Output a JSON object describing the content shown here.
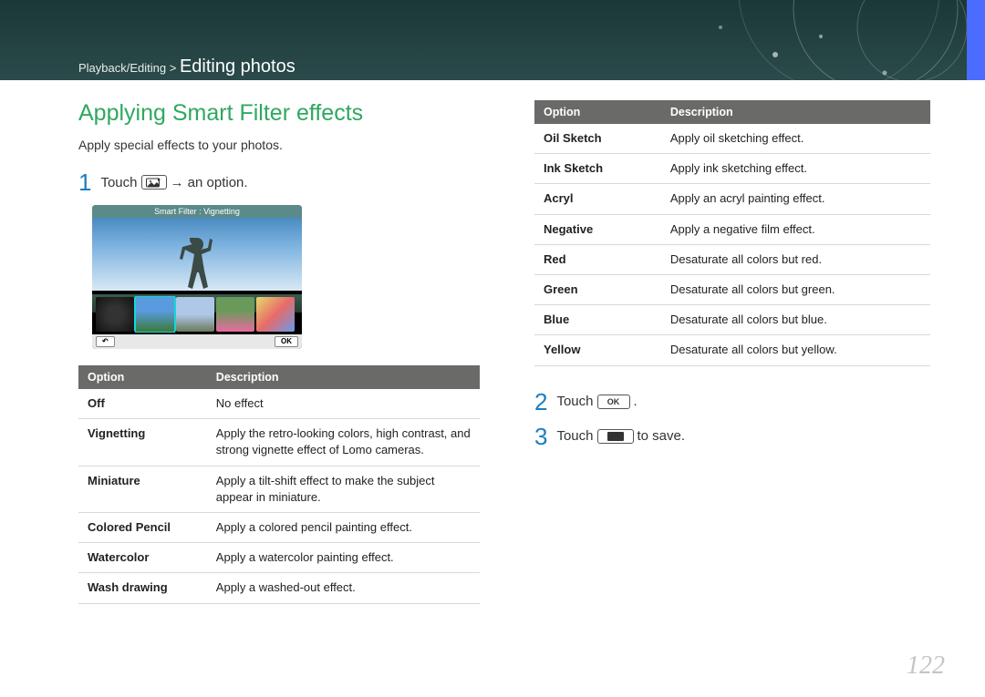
{
  "breadcrumb_parent": "Playback/Editing >",
  "breadcrumb_current": "Editing photos",
  "section_title": "Applying Smart Filter effects",
  "intro_text": "Apply special effects to your photos.",
  "step1": {
    "num": "1",
    "prefix": "Touch",
    "suffix": "→ an option."
  },
  "screenshot_title": "Smart Filter : Vignetting",
  "screenshot_ok": "OK",
  "screenshot_back": "↶",
  "table_headers": {
    "option": "Option",
    "description": "Description"
  },
  "left_table": [
    {
      "option": "Off",
      "desc": "No effect"
    },
    {
      "option": "Vignetting",
      "desc": "Apply the retro-looking colors, high contrast, and strong vignette effect of Lomo cameras."
    },
    {
      "option": "Miniature",
      "desc": "Apply a tilt-shift effect to make the subject appear in miniature."
    },
    {
      "option": "Colored Pencil",
      "desc": "Apply a colored pencil painting effect."
    },
    {
      "option": "Watercolor",
      "desc": "Apply a watercolor painting effect."
    },
    {
      "option": "Wash drawing",
      "desc": "Apply a washed-out effect."
    }
  ],
  "right_table": [
    {
      "option": "Oil Sketch",
      "desc": "Apply oil sketching effect."
    },
    {
      "option": "Ink Sketch",
      "desc": "Apply ink sketching effect."
    },
    {
      "option": "Acryl",
      "desc": "Apply an acryl painting effect."
    },
    {
      "option": "Negative",
      "desc": "Apply a negative film effect."
    },
    {
      "option": "Red",
      "desc": "Desaturate all colors but red."
    },
    {
      "option": "Green",
      "desc": "Desaturate all colors but green."
    },
    {
      "option": "Blue",
      "desc": "Desaturate all colors but blue."
    },
    {
      "option": "Yellow",
      "desc": "Desaturate all colors but yellow."
    }
  ],
  "step2": {
    "num": "2",
    "prefix": "Touch",
    "ok_label": "OK",
    "suffix": "."
  },
  "step3": {
    "num": "3",
    "prefix": "Touch",
    "suffix": "to save."
  },
  "page_num": "122"
}
